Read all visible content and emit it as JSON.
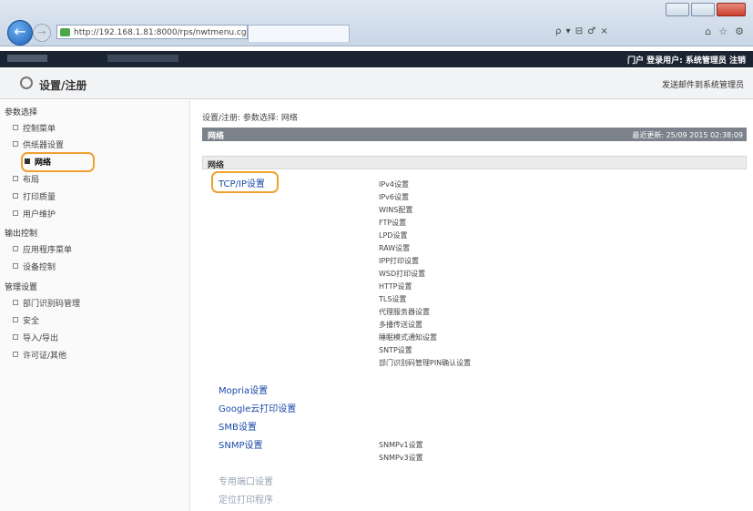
{
  "browser": {
    "url": "http://192.168.1.81:8000/rps/nwtmenu.cgi",
    "toolbar_icons": "ρ ▾ ⊟ ♂ ×"
  },
  "header": {
    "links": "门户  登录用户: 系统管理员  注销"
  },
  "titlebar": {
    "title": "设置/注册",
    "right_link": "发送邮件到系统管理员"
  },
  "sidebar": {
    "section1": "参数选择",
    "items1": [
      "控制菜单",
      "供纸器设置",
      "网络",
      "布局",
      "打印质量",
      "用户维护"
    ],
    "section2": "输出控制",
    "items2": [
      "应用程序菜单",
      "设备控制"
    ],
    "section3": "管理设置",
    "items3": [
      "部门识别码管理",
      "安全",
      "导入/导出",
      "许可证/其他"
    ]
  },
  "main": {
    "breadcrumb": "设置/注册: 参数选择: 网络",
    "section_title": "网络",
    "last_updated": "最近更新: 25/09 2015 02:38:09",
    "subsection_title": "网络",
    "tcpip_label": "TCP/IP设置",
    "tcpip_items": [
      "IPv4设置",
      "IPv6设置",
      "WINS配置",
      "FTP设置",
      "LPD设置",
      "RAW设置",
      "IPP打印设置",
      "WSD打印设置",
      "HTTP设置",
      "TLS设置",
      "代理服务器设置",
      "多播传送设置",
      "睡眠模式通知设置",
      "SNTP设置",
      "部门识别码管理PIN确认设置"
    ],
    "mopria_label": "Mopria设置",
    "google_label": "Google云打印设置",
    "smb_label": "SMB设置",
    "snmp_label": "SNMP设置",
    "snmp_items": [
      "SNMPv1设置",
      "SNMPv3设置"
    ],
    "dedicated_port_label": "专用端口设置",
    "faded_label": "定位打印程序"
  }
}
